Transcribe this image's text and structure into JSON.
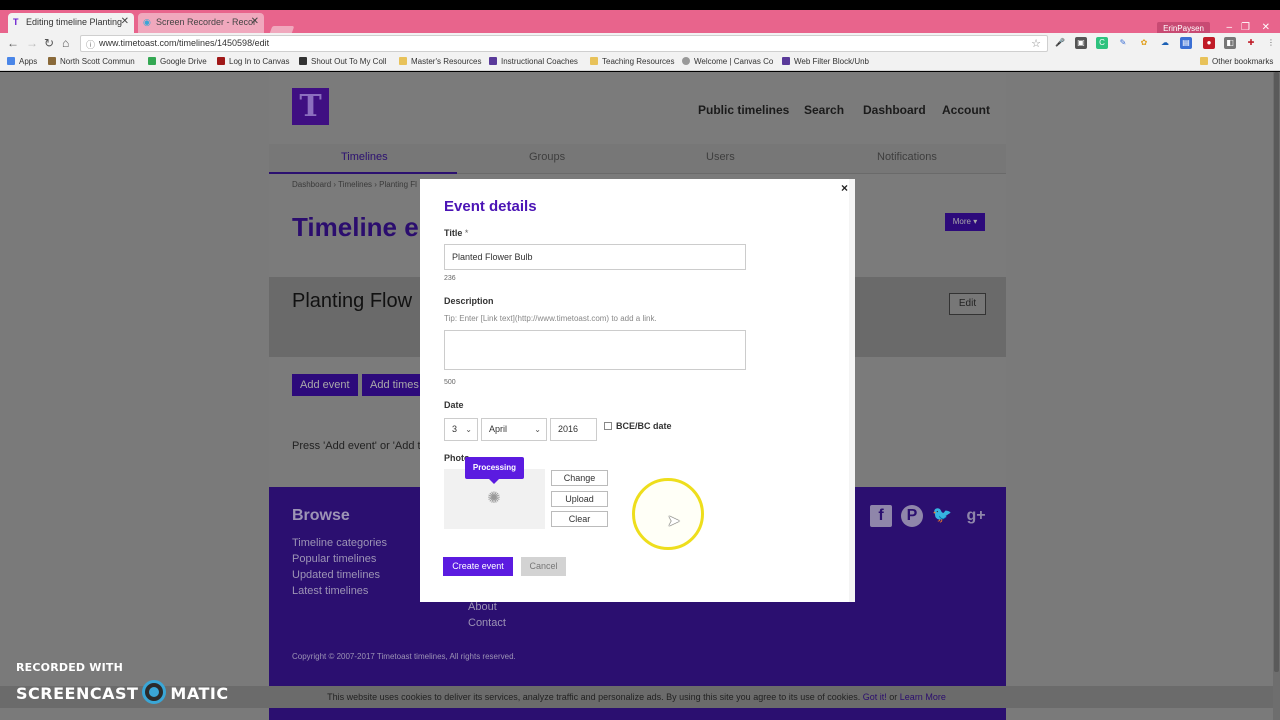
{
  "browser": {
    "tabs": [
      {
        "title": "Editing timeline Planting"
      },
      {
        "title": "Screen Recorder - Recor"
      }
    ],
    "user": "ErinPaysen",
    "url": "www.timetoast.com/timelines/1450598/edit",
    "bookmarks": [
      "Apps",
      "North Scott Commun",
      "Google Drive",
      "Log In to Canvas",
      "Shout Out To My Coll",
      "Master's Resources",
      "Instructional Coaches",
      "Teaching Resources",
      "Welcome | Canvas Co",
      "Web Filter Block/Unb",
      "Other bookmarks"
    ]
  },
  "site": {
    "logo": "T",
    "topnav": [
      "Public timelines",
      "Search",
      "Dashboard",
      "Account"
    ],
    "subnav": [
      "Timelines",
      "Groups",
      "Users",
      "Notifications"
    ],
    "breadcrumb": "Dashboard › Timelines › Planting Fl",
    "page_title": "Timeline e",
    "more_label": "More ▾",
    "timeline_title": "Planting Flow",
    "edit_label": "Edit",
    "add_event": "Add event",
    "add_timespan": "Add times",
    "press_text": "Press 'Add event' or 'Add ti",
    "footer": {
      "browse": "Browse",
      "col1": [
        "Timeline categories",
        "Popular timelines",
        "Updated timelines",
        "Latest timelines"
      ],
      "col2": [
        "About",
        "Contact"
      ],
      "copyright": "Copyright © 2007-2017 Timetoast timelines, All rights reserved."
    },
    "cookie": {
      "text": "This website uses cookies to deliver its services, analyze traffic and personalize ads. By using this site you agree to its use of cookies. ",
      "got_it": "Got it!",
      "or": " or ",
      "learn_more": "Learn More"
    }
  },
  "modal": {
    "close": "×",
    "title": "Event details",
    "title_label": "Title",
    "required_mark": "*",
    "title_value": "Planted Flower Bulb",
    "title_count": "236",
    "description_label": "Description",
    "description_tip": "Tip: Enter [Link text](http://www.timetoast.com) to add a link.",
    "description_value": "",
    "description_count": "500",
    "date_label": "Date",
    "day": "3",
    "month": "April",
    "year": "2016",
    "bce_label": "BCE/BC date",
    "photo_label": "Photo",
    "processing": "Processing",
    "change": "Change",
    "upload": "Upload",
    "clear": "Clear",
    "create": "Create event",
    "cancel": "Cancel"
  },
  "watermark": {
    "line1": "RECORDED WITH",
    "brand_left": "SCREENCAST",
    "brand_right": "MATIC"
  },
  "colors": {
    "brand_purple": "#5b1be0",
    "tab_bar": "#e8648c",
    "footer": "#2b0f70"
  }
}
